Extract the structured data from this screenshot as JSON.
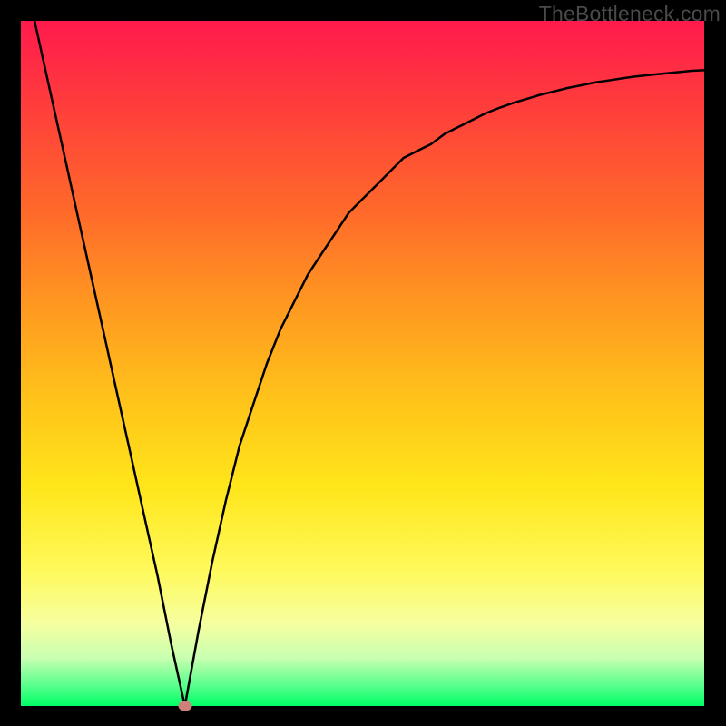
{
  "watermark": {
    "text": "TheBottleneck.com"
  },
  "chart_data": {
    "type": "line",
    "title": "",
    "xlabel": "",
    "ylabel": "",
    "xlim": [
      0,
      100
    ],
    "ylim": [
      0,
      100
    ],
    "grid": false,
    "legend": false,
    "minimum_marker": {
      "x": 24,
      "y": 0
    },
    "series": [
      {
        "name": "curve",
        "x": [
          2,
          4,
          6,
          8,
          10,
          12,
          14,
          16,
          18,
          20,
          22,
          24,
          26,
          28,
          30,
          32,
          34,
          36,
          38,
          40,
          42,
          44,
          46,
          48,
          50,
          52,
          54,
          56,
          58,
          60,
          62,
          64,
          66,
          68,
          70,
          72,
          74,
          76,
          78,
          80,
          82,
          84,
          86,
          88,
          90,
          92,
          94,
          96,
          98,
          100
        ],
        "y": [
          100,
          91,
          82,
          73,
          64,
          55,
          46,
          37,
          28,
          19,
          9,
          0,
          11,
          21,
          30,
          38,
          44,
          50,
          55,
          59,
          63,
          66,
          69,
          72,
          74,
          76,
          78,
          80,
          81,
          82,
          83.5,
          84.5,
          85.5,
          86.5,
          87.3,
          88,
          88.6,
          89.2,
          89.7,
          90.2,
          90.6,
          91,
          91.3,
          91.6,
          91.9,
          92.1,
          92.3,
          92.5,
          92.7,
          92.8
        ]
      }
    ],
    "background_gradient_stops": [
      {
        "pct": 0,
        "color": "#ff1a4d"
      },
      {
        "pct": 12,
        "color": "#ff3c3c"
      },
      {
        "pct": 28,
        "color": "#ff6a2a"
      },
      {
        "pct": 42,
        "color": "#ff9a20"
      },
      {
        "pct": 55,
        "color": "#ffc21a"
      },
      {
        "pct": 68,
        "color": "#ffe61a"
      },
      {
        "pct": 80,
        "color": "#fff95a"
      },
      {
        "pct": 88,
        "color": "#f6ffa0"
      },
      {
        "pct": 93,
        "color": "#c8ffb0"
      },
      {
        "pct": 97,
        "color": "#58ff8c"
      },
      {
        "pct": 100,
        "color": "#00ff66"
      }
    ]
  }
}
